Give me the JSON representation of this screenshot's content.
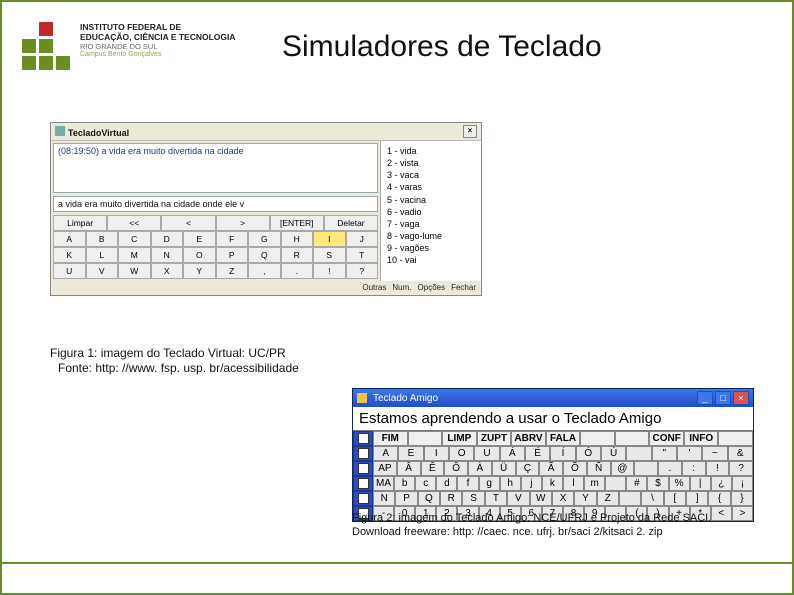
{
  "title": "Simuladores de Teclado",
  "logo": {
    "line1": "INSTITUTO FEDERAL DE",
    "line2": "EDUCAÇÃO, CIÊNCIA E TECNOLOGIA",
    "line3": "RIO GRANDE DO SUL",
    "line4": "Campus Bento Gonçalves"
  },
  "figure1": {
    "window_title": "TecladoVirtual",
    "message": "(08:19:50) a vida era muito divertida na cidade",
    "input": "a vida era muito divertida na cidade onde ele v",
    "buttons": [
      "Limpar",
      "<<",
      "<",
      ">",
      "[ENTER]",
      "Deletar"
    ],
    "row1": [
      "A",
      "B",
      "C",
      "D",
      "E",
      "F",
      "G",
      "H",
      "I",
      "J"
    ],
    "row2": [
      "K",
      "L",
      "M",
      "N",
      "O",
      "P",
      "Q",
      "R",
      "S",
      "T"
    ],
    "row3": [
      "U",
      "V",
      "W",
      "X",
      "Y",
      "Z",
      ",",
      ".",
      "!",
      "?"
    ],
    "suggestions": [
      "1 - vida",
      "2 - vista",
      "3 - vaca",
      "4 - varas",
      "5 - vacina",
      "6 - vadio",
      "7 - vaga",
      "8 - vago-lume",
      "9 - vagões",
      "10 - vai"
    ],
    "bottom": [
      "Outras",
      "Num.",
      "Opções",
      "Fechar"
    ],
    "highlight": "I",
    "caption": "Figura 1: imagem do Teclado Virtual: UC/PR",
    "source": "Fonte: http: //www. fsp. usp. br/acessibilidade"
  },
  "figure2": {
    "window_title": "Teclado Amigo",
    "banner": "Estamos aprendendo a usar o Teclado Amigo",
    "rows": [
      {
        "hdr": [
          "FIM",
          "",
          "LIMP",
          "ZUPT",
          "ABRV",
          "FALA",
          "",
          "",
          "CONF",
          "INFO",
          ""
        ]
      },
      {
        "cells": [
          "A",
          "E",
          "I",
          "O",
          "U",
          "Á",
          "É",
          "Í",
          "Ó",
          "Ú",
          "",
          "\"",
          "'",
          "~",
          "&"
        ]
      },
      {
        "cells": [
          "AP",
          "Â",
          "Ê",
          "Ô",
          "À",
          "Ü",
          "Ç",
          "Ã",
          "Õ",
          "Ñ",
          "@",
          "",
          ".",
          ":",
          "!",
          "?"
        ]
      },
      {
        "cells": [
          "MA",
          "b",
          "c",
          "d",
          "f",
          "g",
          "h",
          "j",
          "k",
          "l",
          "m",
          "",
          "#",
          "$",
          "%",
          "|",
          "¿",
          "¡"
        ]
      },
      {
        "cells": [
          "N",
          "P",
          "Q",
          "R",
          "S",
          "T",
          "V",
          "W",
          "X",
          "Y",
          "Z",
          "",
          "\\",
          "[",
          "]",
          "{",
          "}"
        ]
      },
      {
        "cells": [
          "-",
          "0",
          "1",
          "2",
          "3",
          "4",
          "5",
          "6",
          "7",
          "8",
          "9",
          "",
          "(",
          ")",
          "+",
          "*",
          "<",
          ">"
        ]
      }
    ],
    "caption": "Figura 2: imagem do Teclado Amigo: NCE/UFRJ e Projeto da Rede SACI.",
    "download": "Download freeware: http: //caec. nce. ufrj. br/saci 2/kitsaci 2. zip"
  }
}
